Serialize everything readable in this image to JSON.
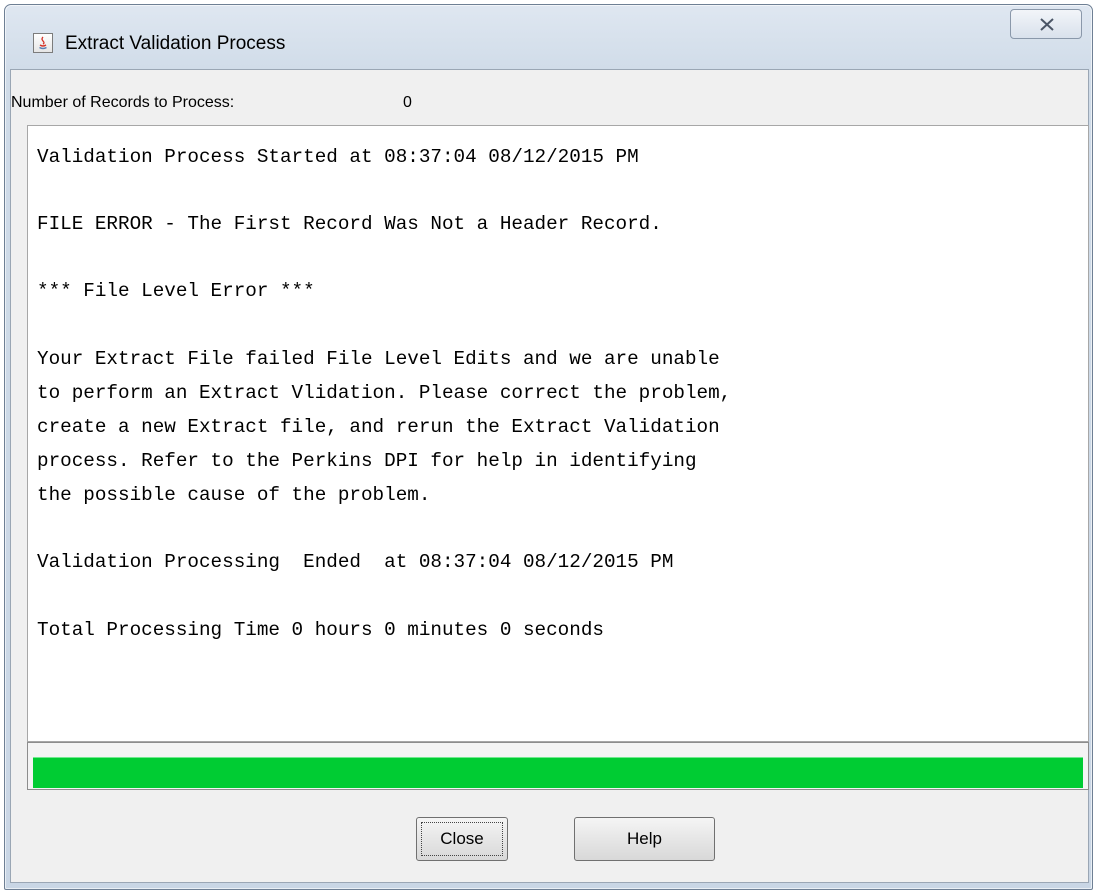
{
  "window": {
    "title": "Extract Validation Process",
    "app_icon": "java-icon",
    "close_icon": "close-x-icon"
  },
  "records": {
    "label": "Number of Records to Process:",
    "value": "0"
  },
  "log": {
    "lines": [
      "Validation Process Started at 08:37:04 08/12/2015 PM",
      "FILE ERROR - The First Record Was Not a Header Record.",
      "*** File Level Error ***",
      "Your Extract File failed File Level Edits and we are unable",
      "to perform an Extract Vlidation. Please correct the problem,",
      "create a new Extract file, and rerun the Extract Validation",
      "process. Refer to the Perkins DPI for help in identifying",
      "the possible cause of the problem.",
      "Validation Processing  Ended  at 08:37:04 08/12/2015 PM",
      "Total Processing Time 0 hours 0 minutes 0 seconds"
    ]
  },
  "progress": {
    "fraction": 1.0,
    "color": "#00cc33"
  },
  "buttons": {
    "close_label": "Close",
    "help_label": "Help"
  }
}
